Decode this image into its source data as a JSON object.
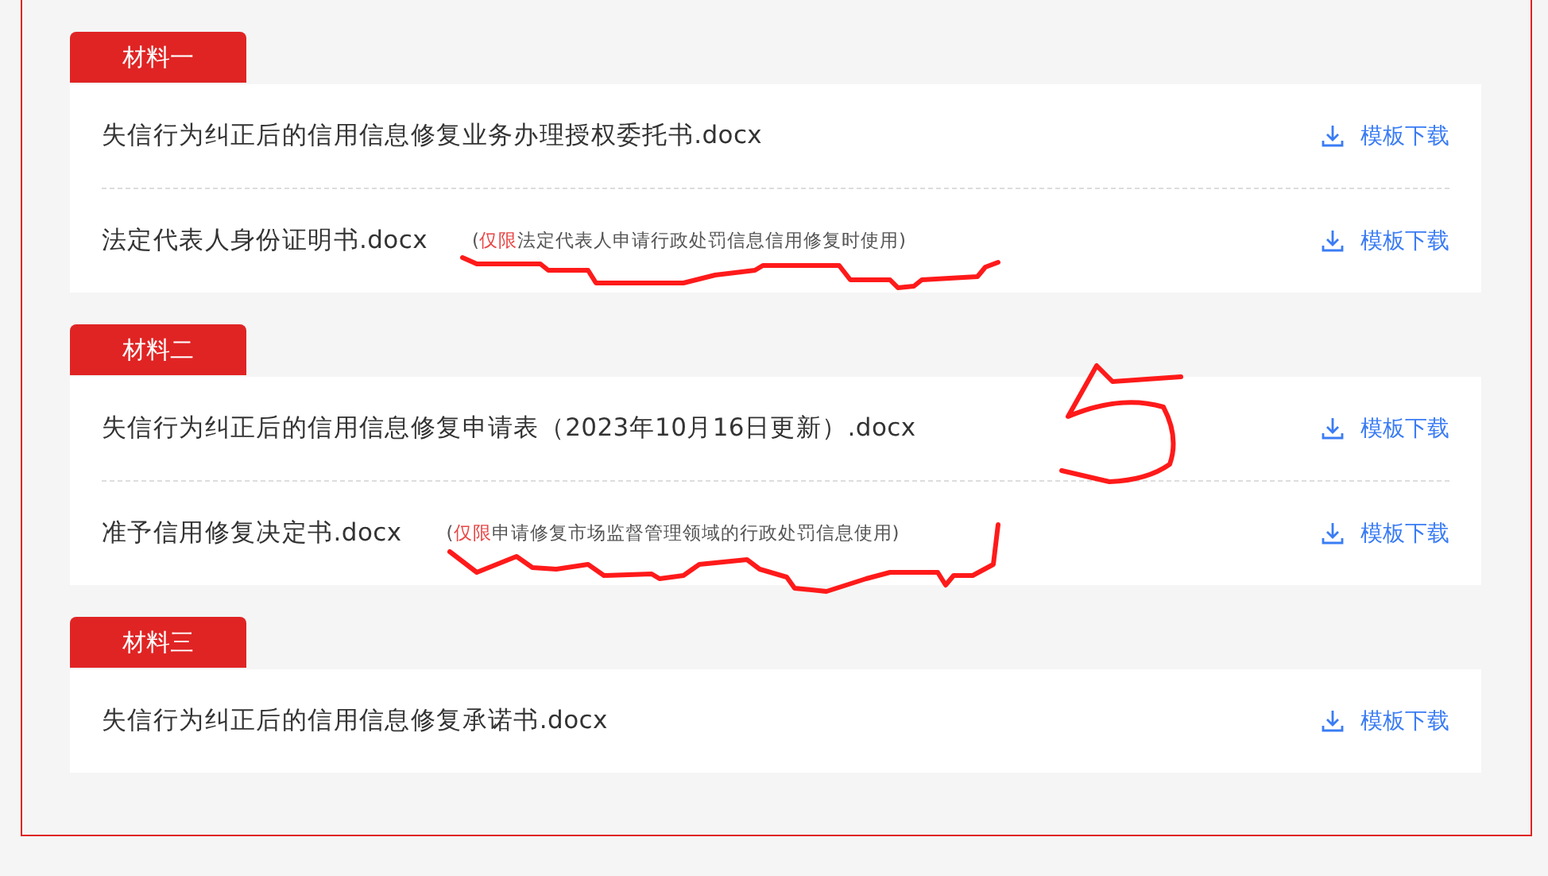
{
  "sections": [
    {
      "title": "材料一",
      "files": [
        {
          "name": "失信行为纠正后的信用信息修复业务办理授权委托书.docx",
          "link": "模板下载"
        },
        {
          "name": "法定代表人身份证明书.docx",
          "note": {
            "open": "(",
            "highlight": "仅限",
            "rest": "法定代表人申请行政处罚信息信用修复时使用)"
          },
          "link": "模板下载"
        }
      ]
    },
    {
      "title": "材料二",
      "files": [
        {
          "name": "失信行为纠正后的信用信息修复申请表（2023年10月16日更新）.docx",
          "link": "模板下载"
        },
        {
          "name": "准予信用修复决定书.docx",
          "note": {
            "open": "(",
            "highlight": "仅限",
            "rest": "申请修复市场监督管理领域的行政处罚信息使用)"
          },
          "link": "模板下载"
        }
      ]
    },
    {
      "title": "材料三",
      "files": [
        {
          "name": "失信行为纠正后的信用信息修复承诺书.docx",
          "link": "模板下载"
        }
      ]
    }
  ]
}
